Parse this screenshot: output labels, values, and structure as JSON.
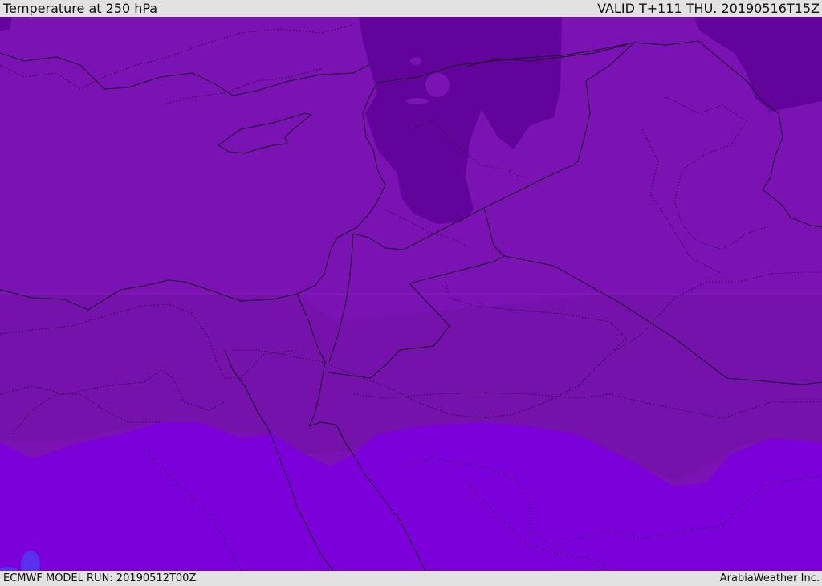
{
  "header": {
    "title": "Temperature at 250 hPa",
    "valid_time": "VALID T+111 THU. 20190516T15Z"
  },
  "footer": {
    "model_run": "ECMWF MODEL RUN: 20190512T00Z",
    "credit": "ArabiaWeather Inc."
  },
  "map": {
    "colors": {
      "base_purple": "#7b12b3",
      "mid_purple": "#7512ab",
      "dark_purple": "#62049b",
      "violet_south": "#7c00d9",
      "blue_patch": "#5a2ff0",
      "boundary_line": "#1a0026"
    }
  }
}
